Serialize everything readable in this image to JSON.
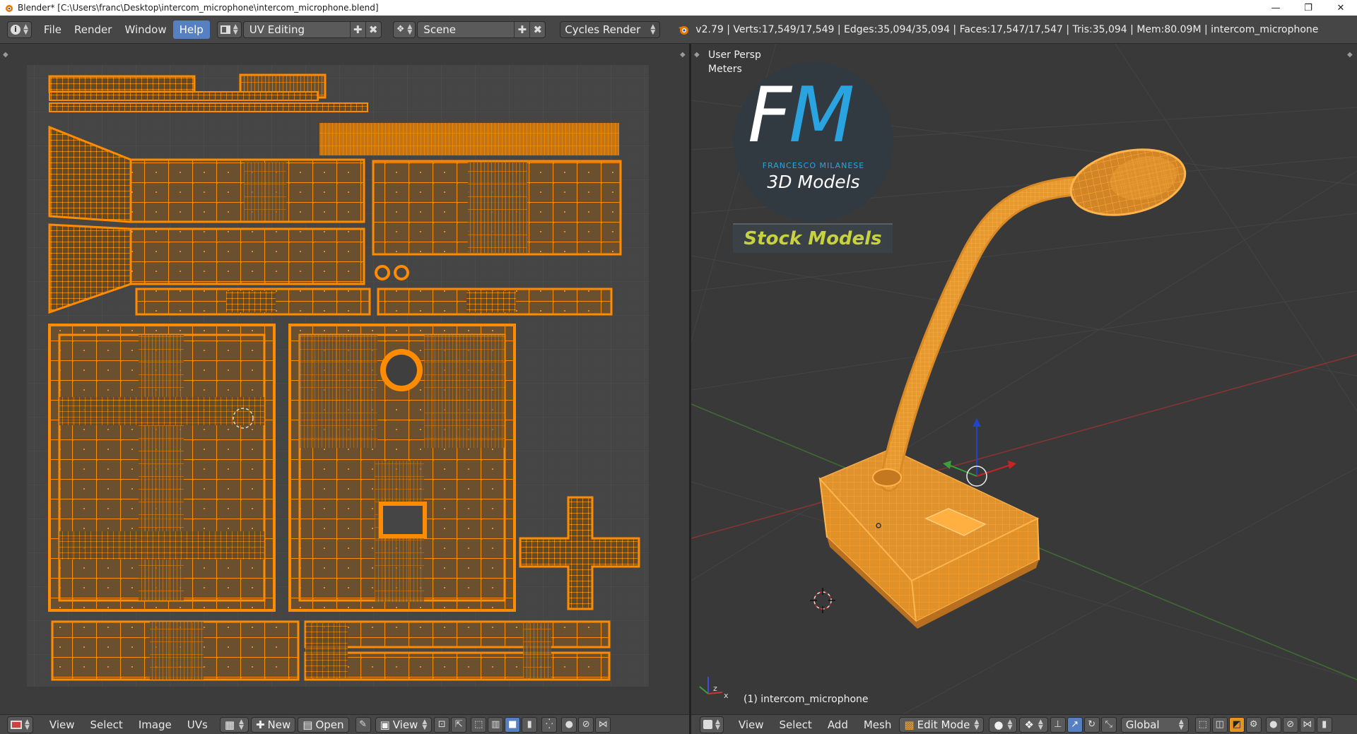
{
  "window": {
    "title": "Blender* [C:\\Users\\franc\\Desktop\\intercom_microphone\\intercom_microphone.blend]",
    "minimize_glyph": "—",
    "restore_glyph": "❐",
    "close_glyph": "✕"
  },
  "info_header": {
    "menus": [
      "File",
      "Render",
      "Window",
      "Help"
    ],
    "screen_layout": "UV Editing",
    "scene": "Scene",
    "render_engine": "Cycles Render",
    "stats": "v2.79 | Verts:17,549/17,549 | Edges:35,094/35,094 | Faces:17,547/17,547 | Tris:35,094 | Mem:80.09M | intercom_microphone"
  },
  "uv_editor": {
    "header_menus": [
      "View",
      "Select",
      "Image",
      "UVs"
    ],
    "new_label": "New",
    "open_label": "Open",
    "view_label": "View"
  },
  "viewport": {
    "view_name": "User Persp",
    "units": "Meters",
    "object_label": "(1) intercom_microphone",
    "header_menus": [
      "View",
      "Select",
      "Add",
      "Mesh"
    ],
    "mode": "Edit Mode",
    "orientation": "Global",
    "axis_z": "z",
    "axis_x": "x"
  },
  "watermark": {
    "letter_f": "F",
    "letter_m": "M",
    "author": "FRANCESCO MILANESE",
    "subtitle": "3D Models",
    "badge": "Stock Models"
  },
  "colors": {
    "uv_orange": "#ff8c00",
    "mesh_orange": "#f0a030",
    "selected_menu": "#5680c2",
    "logo_blue": "#29a4e0",
    "badge_yellow": "#c8d23c"
  }
}
